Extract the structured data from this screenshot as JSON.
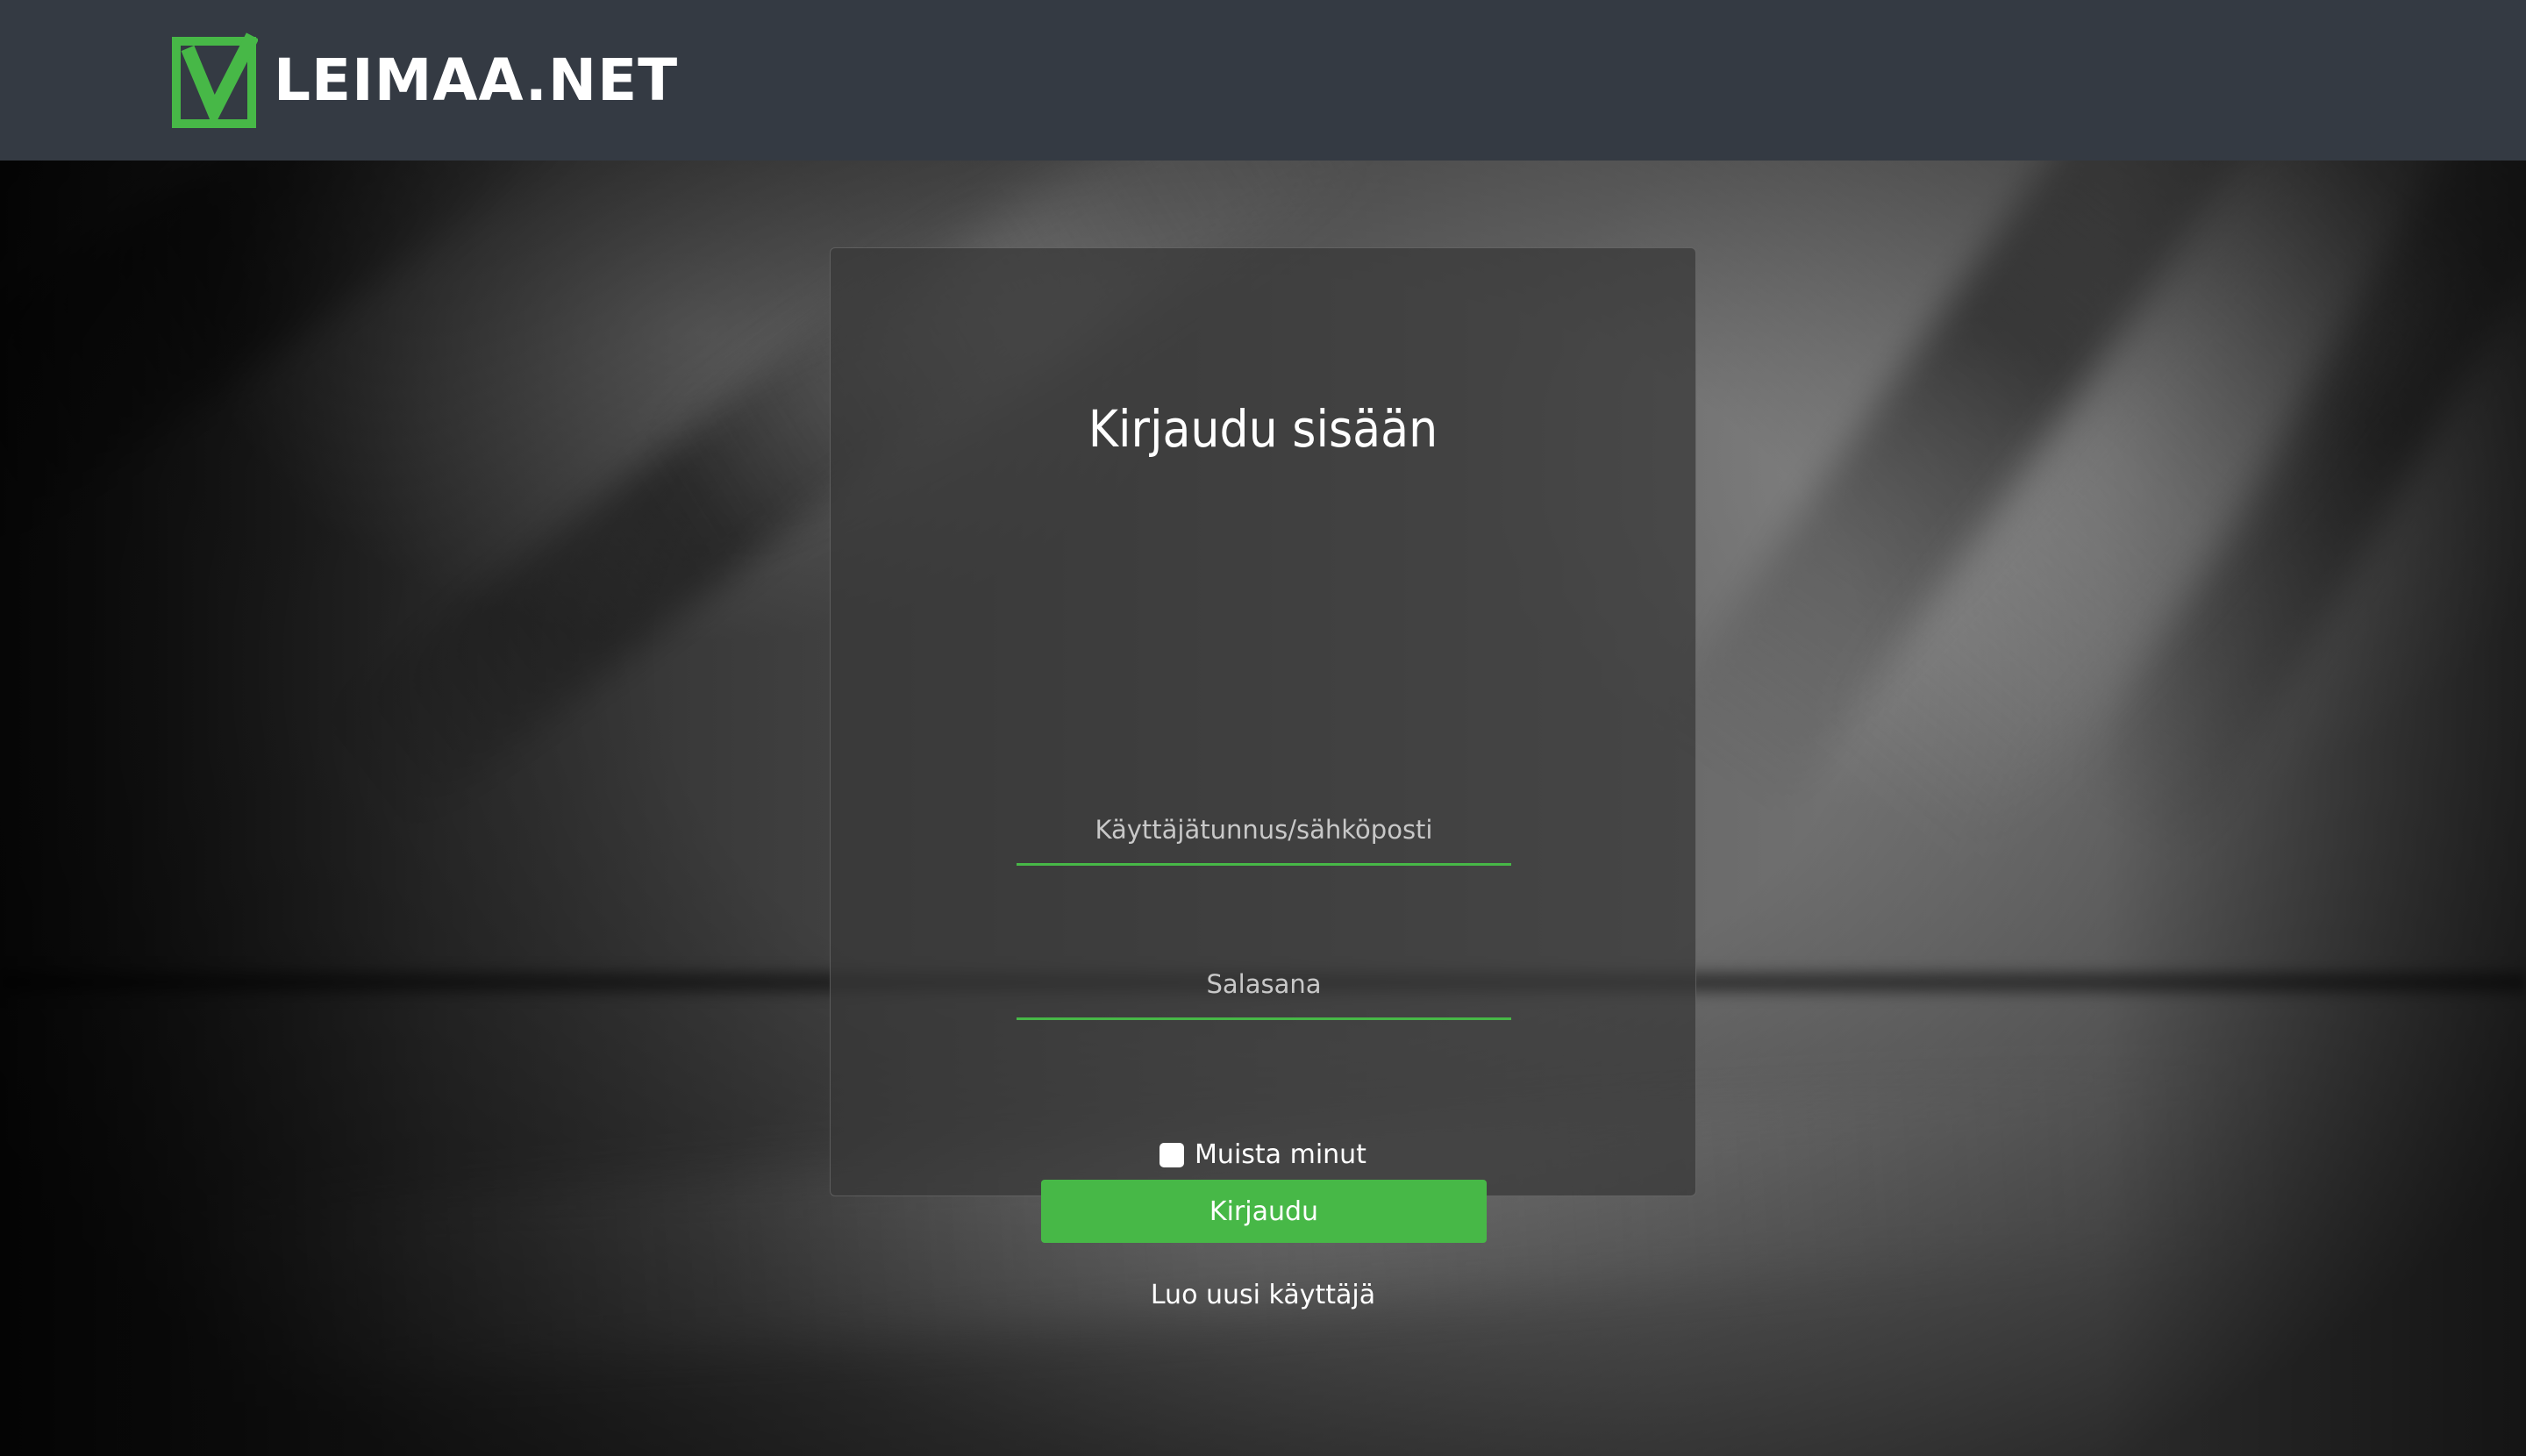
{
  "header": {
    "logo_text": "LEIMAA.NET",
    "background_color": "#343a43",
    "accent_color": "#47b847"
  },
  "login": {
    "title": "Kirjaudu sisään",
    "username_placeholder": "Käyttäjätunnus/sähköposti",
    "username_value": "",
    "password_placeholder": "Salasana",
    "password_value": "",
    "remember_label": "Muista minut",
    "remember_checked": false,
    "submit_label": "Kirjaudu",
    "register_label": "Luo uusi käyttäjä"
  }
}
